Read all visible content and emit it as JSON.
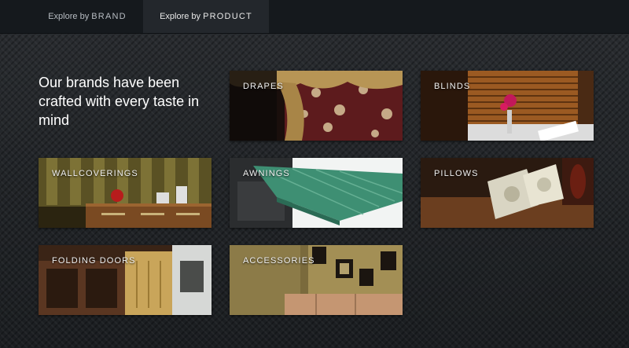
{
  "nav": {
    "tabs": [
      {
        "prefix": "Explore by",
        "strong": "BRAND",
        "active": false
      },
      {
        "prefix": "Explore by",
        "strong": "PRODUCT",
        "active": true
      }
    ]
  },
  "intro": {
    "heading": "Our brands have been crafted with every taste in mind"
  },
  "products": [
    {
      "label": "DRAPES"
    },
    {
      "label": "BLINDS"
    },
    {
      "label": "WALLCOVERINGS"
    },
    {
      "label": "AWNINGS"
    },
    {
      "label": "PILLOWS"
    },
    {
      "label": "FOLDING DOORS"
    },
    {
      "label": "ACCESSORIES"
    }
  ],
  "colors": {
    "background": "#1d2023",
    "topbar": "#15191d",
    "active_tab": "#23272c",
    "text": "#ffffff"
  }
}
